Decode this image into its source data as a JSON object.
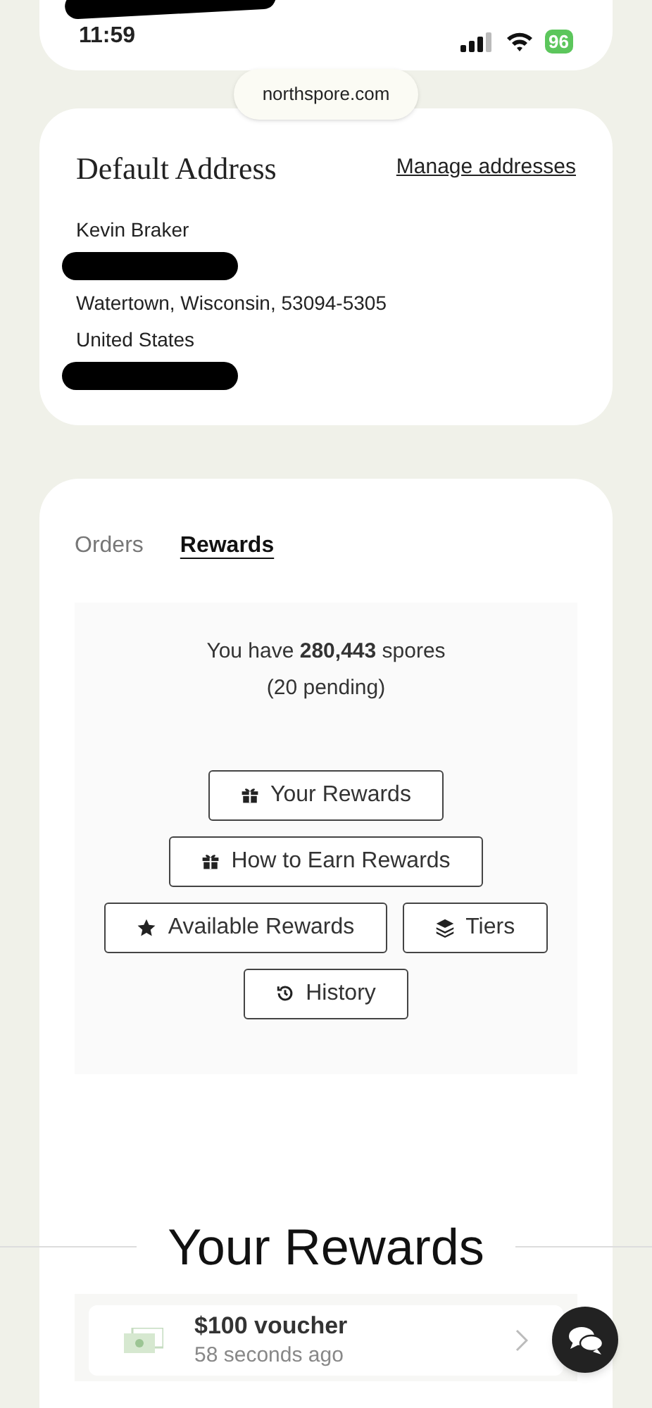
{
  "status_bar": {
    "time": "11:59",
    "redacted": true,
    "battery": "96"
  },
  "url": "northspore.com",
  "address": {
    "title": "Default Address",
    "manage_link": "Manage addresses",
    "lines": [
      {
        "kind": "text",
        "text": "Kevin Braker"
      },
      {
        "kind": "redacted"
      },
      {
        "kind": "text",
        "text": "Watertown, Wisconsin, 53094-5305"
      },
      {
        "kind": "text",
        "text": "United States"
      },
      {
        "kind": "redacted"
      }
    ]
  },
  "tabs": [
    {
      "label": "Orders",
      "selected": false
    },
    {
      "label": "Rewards",
      "selected": true
    }
  ],
  "balance": {
    "text": "You have **280,443** spores",
    "pending": "(20 pending)"
  },
  "buttons": [
    {
      "label": "Your Rewards"
    },
    {
      "label": "How to Earn Rewards"
    },
    {
      "label": "Available Rewards"
    },
    {
      "label": "Tiers"
    },
    {
      "label": "History"
    }
  ],
  "rewards_title": "Your Rewards",
  "rewards": [
    {
      "title": "$100 voucher",
      "time": "58 seconds ago"
    }
  ]
}
